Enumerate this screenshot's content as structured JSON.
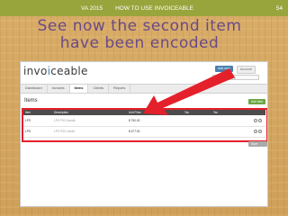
{
  "slide": {
    "course": "VA 2015",
    "topic": "HOW TO USE INVOICEABLE",
    "page_number": "54",
    "headline_line1": "See now the second item",
    "headline_line2": "have been encoded"
  },
  "app": {
    "logo_left": "invo",
    "logo_accent": "i",
    "logo_right": "ceable",
    "add_new_label": "Add new",
    "account_label": "Account",
    "search_placeholder": "Search invoice",
    "tabs": [
      {
        "label": "Dashboard"
      },
      {
        "label": "Invoices"
      },
      {
        "label": "Items"
      },
      {
        "label": "Clients"
      },
      {
        "label": "Reports"
      }
    ],
    "section_title": "Items",
    "add_item_label": "Add Item",
    "columns": [
      "Item",
      "Description",
      "Unit Price",
      "Tax",
      "Tax"
    ],
    "rows": [
      {
        "item": "LPS",
        "description": "LPS P30 Sunsilk",
        "price": "$ 750.00"
      },
      {
        "item": "LPS",
        "description": "LPS P30 Cobalt",
        "price": "$ 677.00"
      }
    ],
    "save_label": "Save Items"
  },
  "colors": {
    "topbar": "#97a53c",
    "headline": "#6b4a88",
    "highlight": "#e4202a",
    "accent": "#4a7fb0"
  }
}
